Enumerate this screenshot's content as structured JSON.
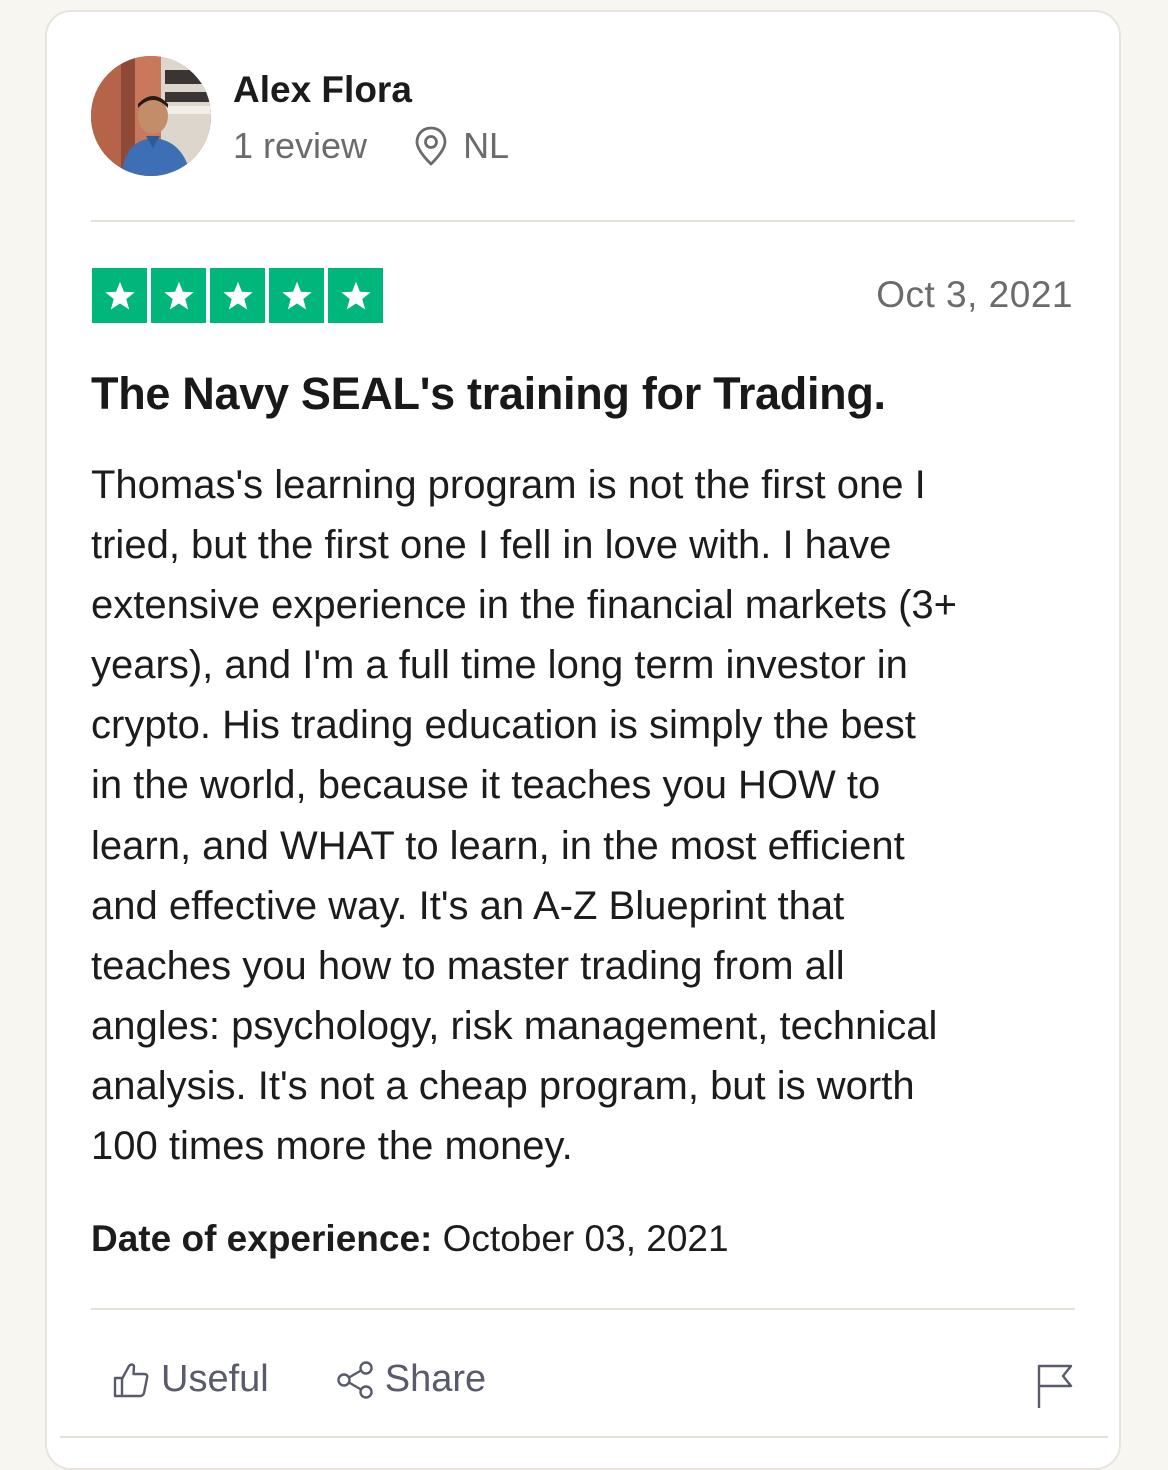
{
  "reviewer": {
    "name": "Alex Flora",
    "review_count": "1 review",
    "country": "NL"
  },
  "rating": {
    "stars": 5,
    "max": 5,
    "color": "#00b67a"
  },
  "review": {
    "date": "Oct 3, 2021",
    "title": "The Navy SEAL's training for Trading.",
    "body_lines": [
      "Thomas's learning program is not the first one I",
      "tried, but the first one I fell in love with. I have",
      "extensive experience in the financial markets (3+",
      "years), and I'm a full time long term investor in",
      "crypto. His trading education is simply the best",
      "in the world, because it teaches you HOW to",
      "learn, and WHAT to learn, in the most efficient",
      "and effective way. It's an A-Z Blueprint that",
      "teaches you how to master trading from all",
      "angles: psychology, risk management, technical",
      "analysis. It's not a cheap program, but is worth",
      "100 times more the money."
    ],
    "experience_label": "Date of experience:",
    "experience_date": "October 03, 2021"
  },
  "actions": {
    "useful_label": "Useful",
    "share_label": "Share"
  },
  "icons": {
    "location": "location-pin-icon",
    "useful": "thumbs-up-icon",
    "share": "share-icon",
    "report": "flag-icon"
  }
}
